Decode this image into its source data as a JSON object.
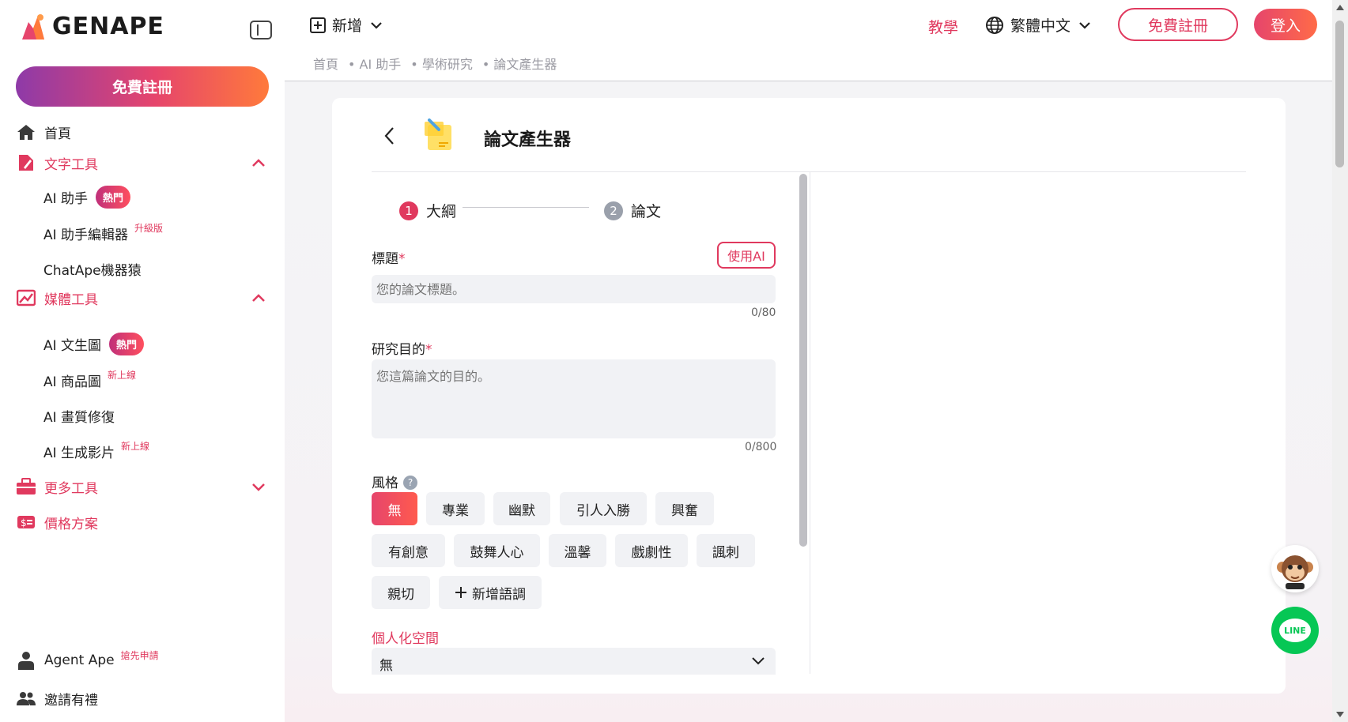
{
  "brand": {
    "name": "GENAPE"
  },
  "sidebar": {
    "register_cta": "免費註冊",
    "home": "首頁",
    "sections": [
      {
        "label": "文字工具",
        "items": [
          {
            "label": "AI 助手",
            "badge": "熱門"
          },
          {
            "label": "AI 助手編輯器",
            "sup": "升級版"
          },
          {
            "label": "ChatApe機器猿"
          }
        ]
      },
      {
        "label": "媒體工具",
        "items": [
          {
            "label": "AI 文生圖",
            "badge": "熱門"
          },
          {
            "label": "AI 商品圖",
            "sup": "新上線"
          },
          {
            "label": "AI 畫質修復"
          },
          {
            "label": "AI 生成影片",
            "sup": "新上線"
          }
        ]
      },
      {
        "label": "更多工具"
      },
      {
        "label": "價格方案"
      }
    ],
    "agent_ape": {
      "label": "Agent Ape",
      "sup": "搶先申請"
    },
    "invite": "邀請有禮"
  },
  "header": {
    "new_label": "新增",
    "breadcrumb": [
      "首頁",
      "• AI 助手",
      "• 學術研究",
      "• 論文產生器"
    ],
    "tutorial": "教學",
    "language": "繁體中文",
    "register": "免費註冊",
    "login": "登入"
  },
  "tool": {
    "title": "論文產生器",
    "steps": [
      {
        "num": "1",
        "label": "大綱"
      },
      {
        "num": "2",
        "label": "論文"
      }
    ],
    "title_field": {
      "label": "標題",
      "required": "*",
      "placeholder": "您的論文標題。",
      "counter": "0/80",
      "use_ai": "使用AI"
    },
    "purpose_field": {
      "label": "研究目的",
      "required": "*",
      "placeholder": "您這篇論文的目的。",
      "counter": "0/800"
    },
    "style": {
      "label": "風格",
      "help": "?",
      "options": [
        "無",
        "專業",
        "幽默",
        "引人入勝",
        "興奮",
        "有創意",
        "鼓舞人心",
        "溫馨",
        "戲劇性",
        "諷刺",
        "親切"
      ],
      "selected": "無",
      "add_tone": "新增語調"
    },
    "personal_space": {
      "label": "個人化空間",
      "value": "無"
    }
  },
  "widgets": {
    "line": "LINE"
  },
  "colors": {
    "accent": "#e0395e",
    "line_green": "#06c755"
  }
}
